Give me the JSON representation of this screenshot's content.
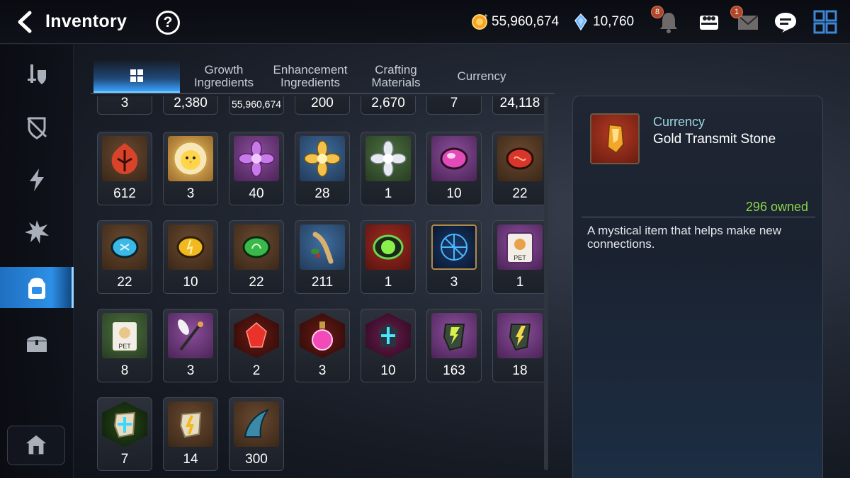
{
  "header": {
    "title": "Inventory",
    "help_label": "?",
    "gold": "55,960,674",
    "skystone": "10,760",
    "notification_count": "8",
    "mail_count": "1"
  },
  "tabs": [
    {
      "label": ""
    },
    {
      "label": "Growth\nIngredients"
    },
    {
      "label": "Enhancement\nIngredients"
    },
    {
      "label": "Crafting\nMaterials"
    },
    {
      "label": "Currency"
    }
  ],
  "top_row_counts": [
    "3",
    "2,380",
    "55,960,674",
    "200",
    "2,670",
    "7",
    "24,118"
  ],
  "items": [
    {
      "name": "flame-leaf",
      "count": "612"
    },
    {
      "name": "chick-medal",
      "count": "3"
    },
    {
      "name": "purple-flower",
      "count": "40"
    },
    {
      "name": "gold-flower",
      "count": "28"
    },
    {
      "name": "silver-flower",
      "count": "1"
    },
    {
      "name": "pink-rune",
      "count": "10"
    },
    {
      "name": "red-rune",
      "count": "22"
    },
    {
      "name": "blue-rune",
      "count": "22"
    },
    {
      "name": "yellow-rune",
      "count": "10"
    },
    {
      "name": "green-rune",
      "count": "22"
    },
    {
      "name": "herb-root",
      "count": "211"
    },
    {
      "name": "green-orb",
      "count": "1"
    },
    {
      "name": "blue-sigil",
      "count": "3"
    },
    {
      "name": "pet-bag-purple",
      "count": "1"
    },
    {
      "name": "pet-bag-green",
      "count": "8"
    },
    {
      "name": "feather-staff",
      "count": "3"
    },
    {
      "name": "red-gem",
      "count": "2"
    },
    {
      "name": "pink-potion",
      "count": "3"
    },
    {
      "name": "blue-star-gem",
      "count": "10"
    },
    {
      "name": "gold-transmit-stone",
      "count": "163"
    },
    {
      "name": "yellow-transmit-stone",
      "count": "18"
    },
    {
      "name": "star-stone",
      "count": "7"
    },
    {
      "name": "bolt-stone",
      "count": "14"
    },
    {
      "name": "blue-claw",
      "count": "300"
    }
  ],
  "detail": {
    "category": "Currency",
    "name": "Gold Transmit Stone",
    "owned": "296 owned",
    "description": "A mystical item that helps make new connections."
  },
  "colors": {
    "accent_blue": "#2d8fe6",
    "owned_green": "#8ad64a",
    "category_cyan": "#9ad7e0"
  }
}
